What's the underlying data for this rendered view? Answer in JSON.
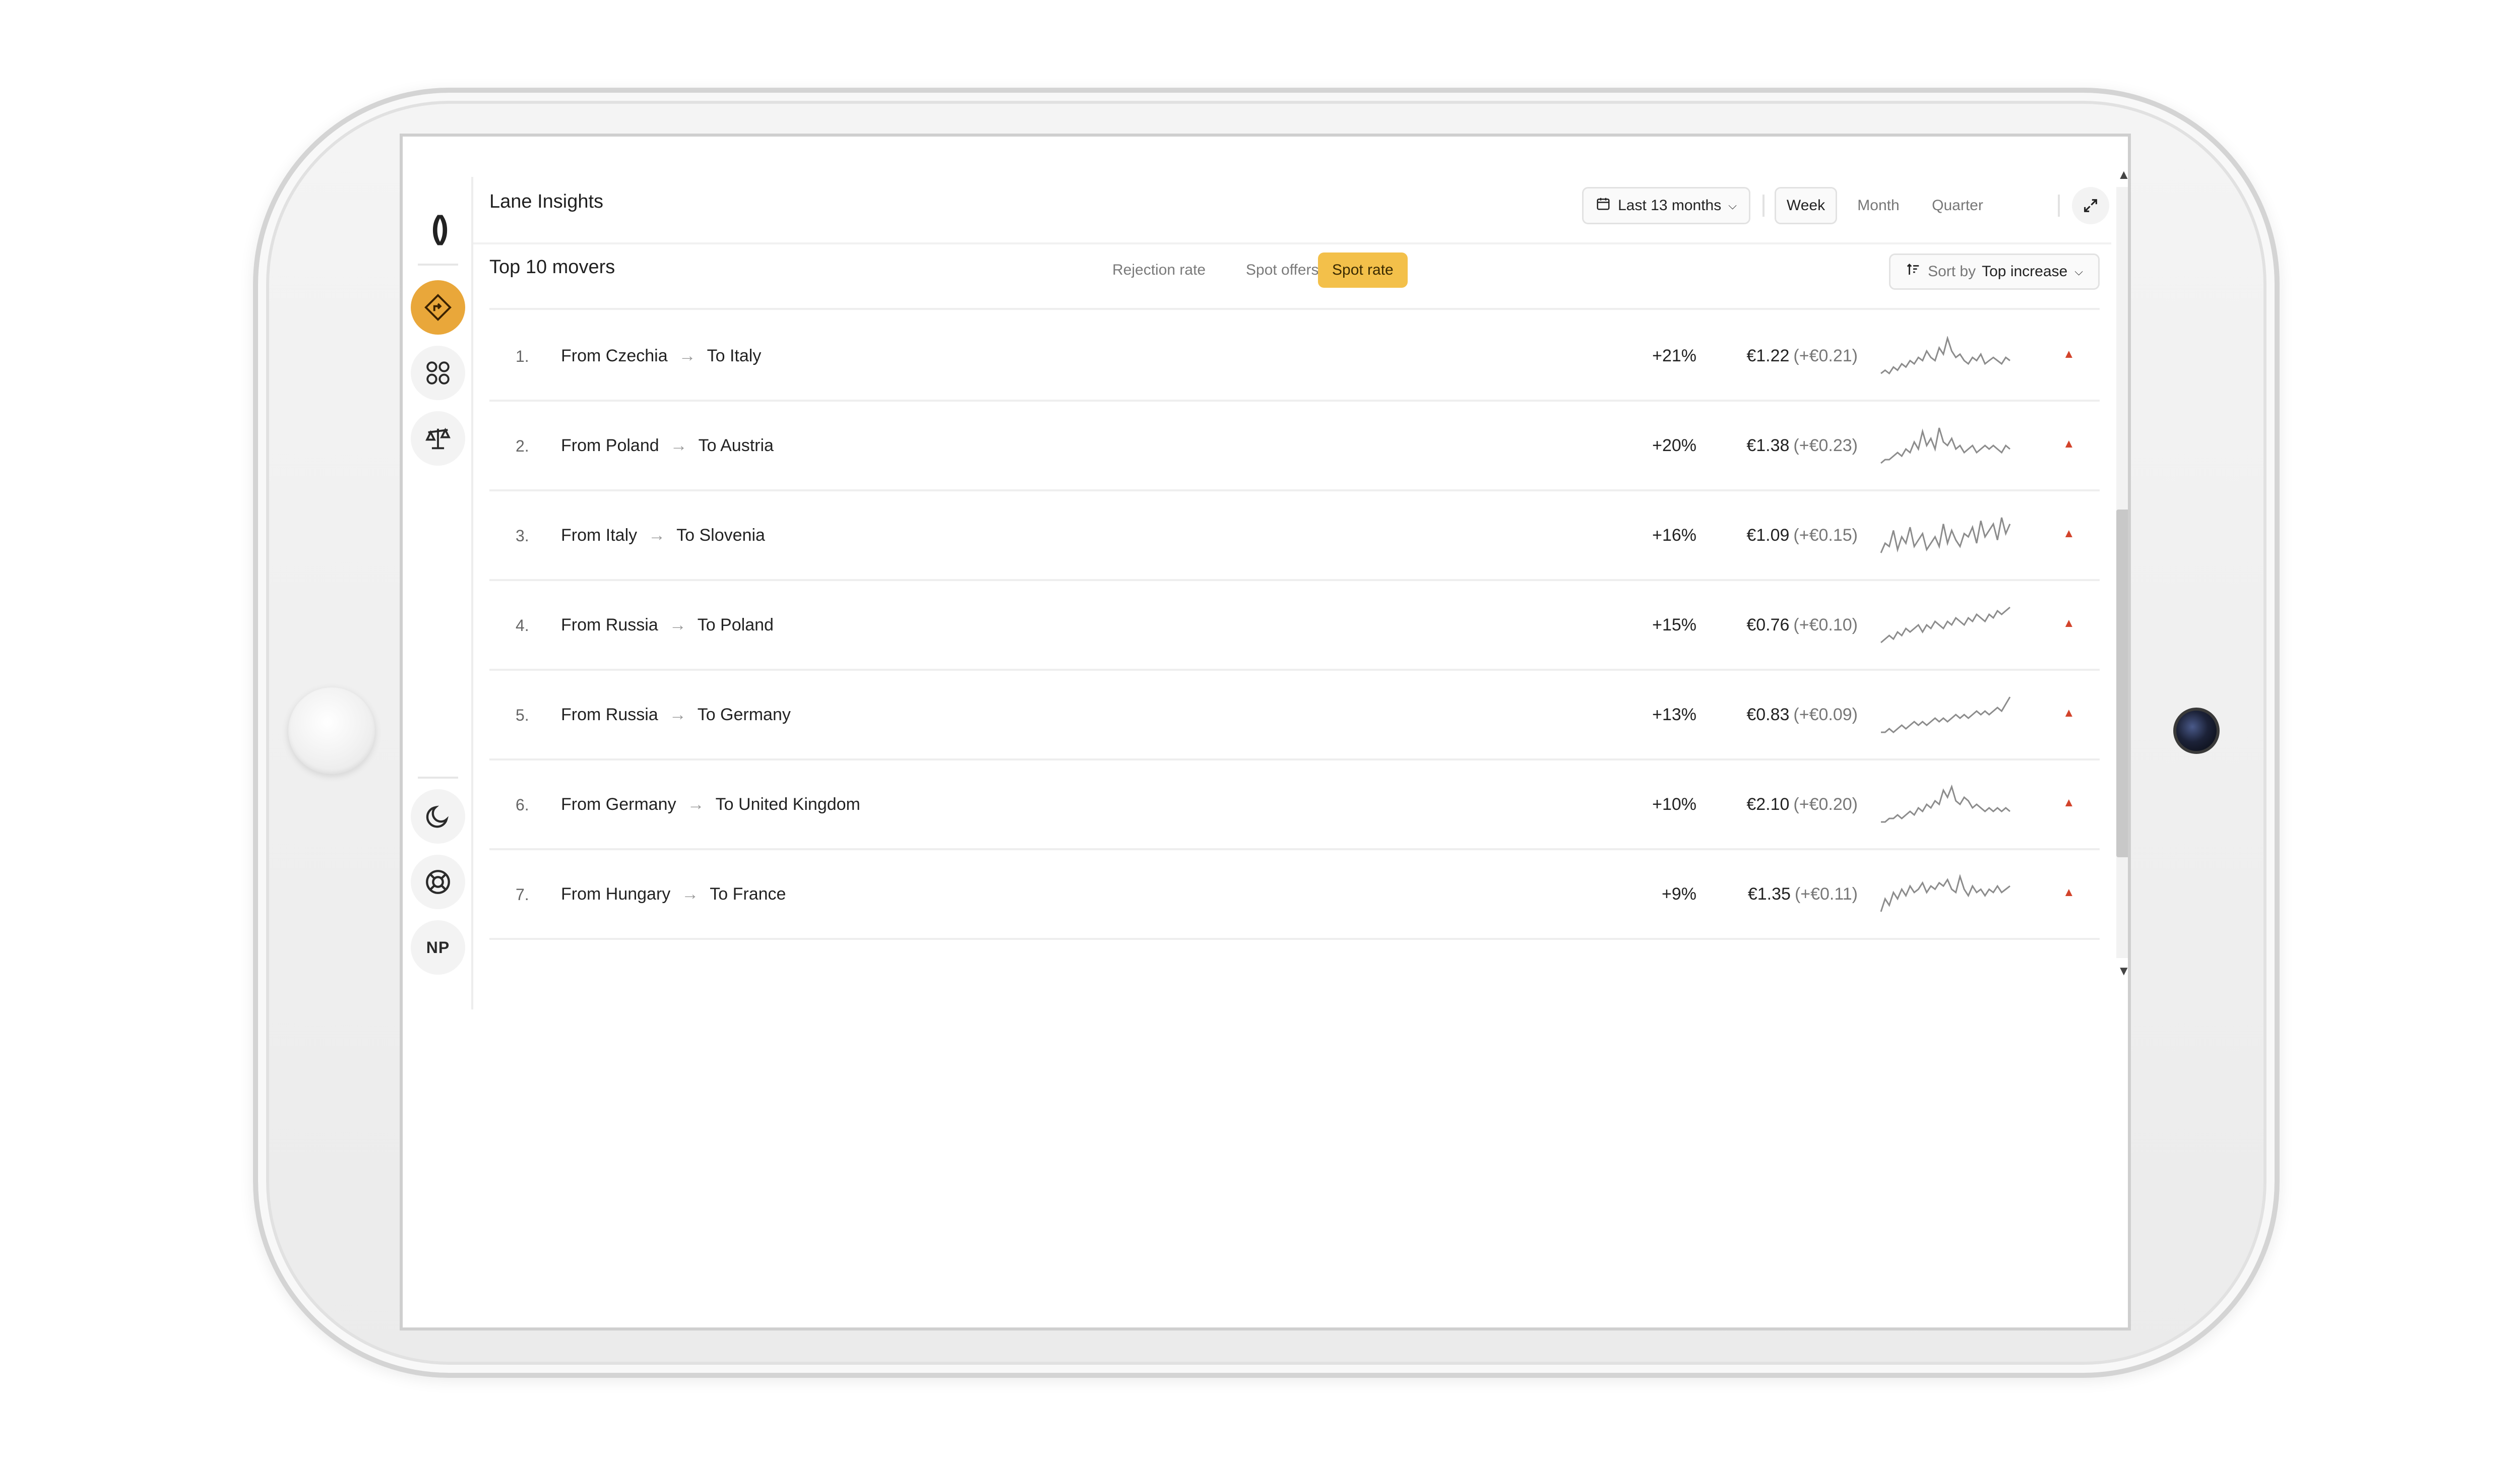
{
  "header": {
    "title": "Lane Insights",
    "date_range": "Last 13 months",
    "periods": [
      "Week",
      "Month",
      "Quarter"
    ],
    "active_period": "Week"
  },
  "section": {
    "title": "Top 10 movers",
    "tabs": [
      "Rejection rate",
      "Spot offers",
      "Spot rate"
    ],
    "active_tab": "Spot rate",
    "sort_label": "Sort by",
    "sort_value": "Top increase"
  },
  "sidebar": {
    "avatar_initials": "NP",
    "items": [
      {
        "icon": "route-sign-icon",
        "active": true
      },
      {
        "icon": "apps-grid-icon",
        "active": false
      },
      {
        "icon": "balance-scale-icon",
        "active": false
      }
    ],
    "bottom_items": [
      {
        "icon": "moon-icon"
      },
      {
        "icon": "lifebuoy-icon"
      }
    ]
  },
  "rows": [
    {
      "rank": "1.",
      "from": "From Czechia",
      "to": "To Italy",
      "pct": "+21%",
      "price": "€1.22",
      "delta": "(+€0.21)",
      "spark": [
        5,
        6,
        5,
        7,
        6,
        8,
        7,
        9,
        8,
        10,
        9,
        12,
        10,
        9,
        13,
        11,
        16,
        12,
        10,
        11,
        9,
        8,
        10,
        9,
        11,
        8,
        9,
        10,
        9,
        8,
        10,
        9
      ]
    },
    {
      "rank": "2.",
      "from": "From Poland",
      "to": "To Austria",
      "pct": "+20%",
      "price": "€1.38",
      "delta": "(+€0.23)",
      "spark": [
        5,
        6,
        6,
        7,
        8,
        7,
        9,
        8,
        11,
        9,
        14,
        10,
        12,
        9,
        15,
        11,
        10,
        12,
        9,
        10,
        8,
        9,
        10,
        8,
        9,
        10,
        9,
        10,
        9,
        8,
        10,
        9
      ]
    },
    {
      "rank": "3.",
      "from": "From Italy",
      "to": "To Slovenia",
      "pct": "+16%",
      "price": "€1.09",
      "delta": "(+€0.15)",
      "spark": [
        6,
        9,
        8,
        13,
        7,
        11,
        9,
        14,
        8,
        10,
        12,
        7,
        9,
        11,
        8,
        15,
        9,
        13,
        10,
        8,
        12,
        11,
        14,
        9,
        16,
        11,
        13,
        15,
        10,
        17,
        12,
        15
      ]
    },
    {
      "rank": "4.",
      "from": "From Russia",
      "to": "To Poland",
      "pct": "+15%",
      "price": "€0.76",
      "delta": "(+€0.10)",
      "spark": [
        5,
        6,
        7,
        6,
        8,
        7,
        9,
        8,
        9,
        10,
        8,
        10,
        9,
        11,
        10,
        9,
        11,
        10,
        12,
        11,
        10,
        12,
        11,
        13,
        12,
        11,
        13,
        12,
        14,
        13,
        14,
        15
      ]
    },
    {
      "rank": "5.",
      "from": "From Russia",
      "to": "To Germany",
      "pct": "+13%",
      "price": "€0.83",
      "delta": "(+€0.09)",
      "spark": [
        6,
        6,
        7,
        6,
        7,
        8,
        7,
        8,
        9,
        8,
        9,
        8,
        9,
        10,
        9,
        10,
        9,
        10,
        11,
        10,
        11,
        10,
        11,
        12,
        11,
        12,
        11,
        12,
        13,
        12,
        14,
        16
      ]
    },
    {
      "rank": "6.",
      "from": "From Germany",
      "to": "To United Kingdom",
      "pct": "+10%",
      "price": "€2.10",
      "delta": "(+€0.20)",
      "spark": [
        6,
        6,
        7,
        7,
        8,
        7,
        8,
        9,
        8,
        10,
        9,
        11,
        10,
        12,
        11,
        15,
        13,
        16,
        12,
        11,
        13,
        12,
        10,
        11,
        10,
        9,
        10,
        9,
        10,
        9,
        10,
        9
      ]
    },
    {
      "rank": "7.",
      "from": "From Hungary",
      "to": "To France",
      "pct": "+9%",
      "price": "€1.35",
      "delta": "(+€0.11)",
      "spark": [
        5,
        9,
        7,
        11,
        9,
        12,
        10,
        13,
        11,
        12,
        14,
        11,
        13,
        12,
        14,
        13,
        15,
        12,
        11,
        16,
        12,
        10,
        13,
        11,
        12,
        10,
        12,
        11,
        13,
        11,
        12,
        13
      ]
    }
  ],
  "colors": {
    "accent": "#e9a73a",
    "tab_active": "#f3c04a",
    "trend_up": "#d2432b",
    "sparkline": "#8c8c8c"
  }
}
